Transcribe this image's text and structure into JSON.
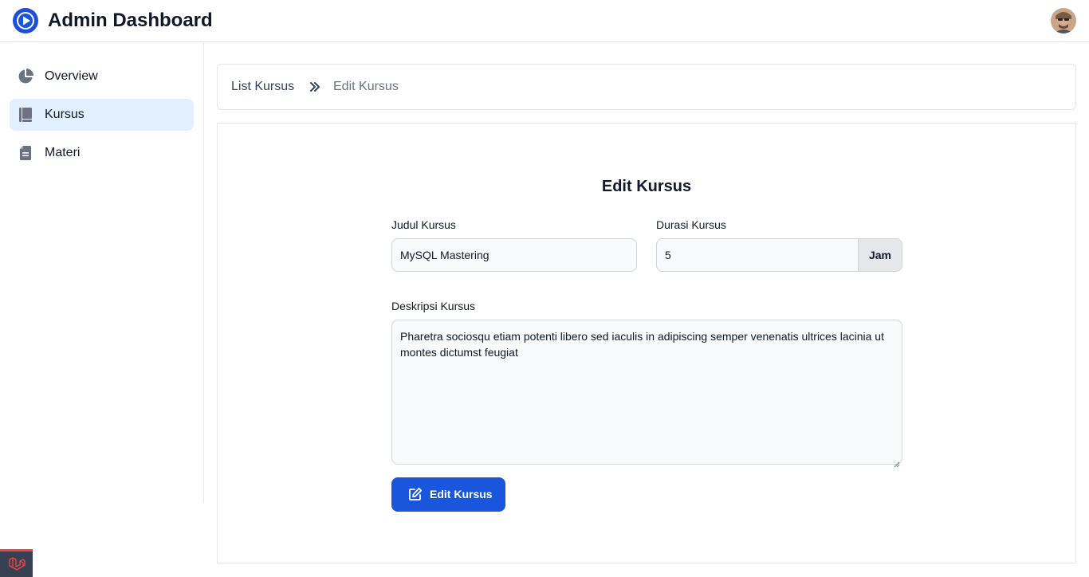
{
  "header": {
    "title": "Admin Dashboard",
    "logo_icon": "play-circle-icon",
    "avatar_icon": "user-avatar"
  },
  "sidebar": {
    "items": [
      {
        "label": "Overview",
        "icon": "pie-chart-icon",
        "active": false
      },
      {
        "label": "Kursus",
        "icon": "book-icon",
        "active": true
      },
      {
        "label": "Materi",
        "icon": "document-icon",
        "active": false
      }
    ]
  },
  "breadcrumb": {
    "items": [
      "List Kursus",
      "Edit Kursus"
    ],
    "separator_icon": "chevron-double-right-icon"
  },
  "form": {
    "title": "Edit Kursus",
    "judul": {
      "label": "Judul Kursus",
      "value": "MySQL Mastering"
    },
    "durasi": {
      "label": "Durasi Kursus",
      "value": "5",
      "addon": "Jam"
    },
    "deskripsi": {
      "label": "Deskripsi Kursus",
      "value": "Pharetra sociosqu etiam potenti libero sed iaculis in adipiscing semper venenatis ultrices lacinia ut montes dictumst feugiat"
    },
    "submit": {
      "label": "Edit Kursus",
      "icon": "edit-icon"
    }
  },
  "colors": {
    "primary": "#1a56db",
    "active_bg": "#e1effe",
    "input_bg": "#f9fafb",
    "border": "#e5e7eb"
  }
}
